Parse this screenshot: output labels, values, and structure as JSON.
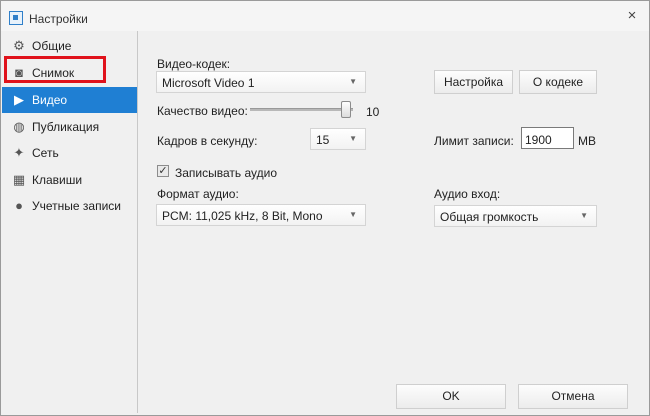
{
  "window": {
    "title": "Настройки",
    "close_glyph": "×",
    "icon": "app-icon"
  },
  "sidebar": {
    "items": [
      {
        "label": "Общие",
        "icon": "gear-icon",
        "glyph": "⚙"
      },
      {
        "label": "Снимок",
        "icon": "camera-icon",
        "glyph": "◙"
      },
      {
        "label": "Видео",
        "icon": "video-camera-icon",
        "glyph": "▶",
        "active": true
      },
      {
        "label": "Публикация",
        "icon": "globe-icon",
        "glyph": "◍"
      },
      {
        "label": "Сеть",
        "icon": "network-icon",
        "glyph": "✦"
      },
      {
        "label": "Клавиши",
        "icon": "keyboard-icon",
        "glyph": "▦"
      },
      {
        "label": "Учетные записи",
        "icon": "user-icon",
        "glyph": "●"
      }
    ]
  },
  "video": {
    "codec_label": "Видео-кодек:",
    "codec_value": "Microsoft Video 1",
    "setup_button": "Настройка",
    "about_codec_button": "О кодеке",
    "quality_label": "Качество видео:",
    "quality_value": "10",
    "quality_level": 1.0,
    "fps_label": "Кадров в секунду:",
    "fps_value": "15",
    "record_limit_label": "Лимит записи:",
    "record_limit_value": "1900",
    "record_limit_unit": "MB",
    "record_audio_label": "Записывать аудио",
    "record_audio_checked": true,
    "check_glyph": "✓",
    "audio_format_label": "Формат аудио:",
    "audio_format_value": "PCM: 11,025 kHz, 8 Bit, Mono",
    "audio_input_label": "Аудио вход:",
    "audio_input_value": "Общая громкость",
    "dropdown_arrow": "▼"
  },
  "footer": {
    "ok_button": "OK",
    "cancel_button": "Отмена"
  },
  "colors": {
    "accent": "#1f7fd3",
    "highlight_box": "#e0121b"
  }
}
